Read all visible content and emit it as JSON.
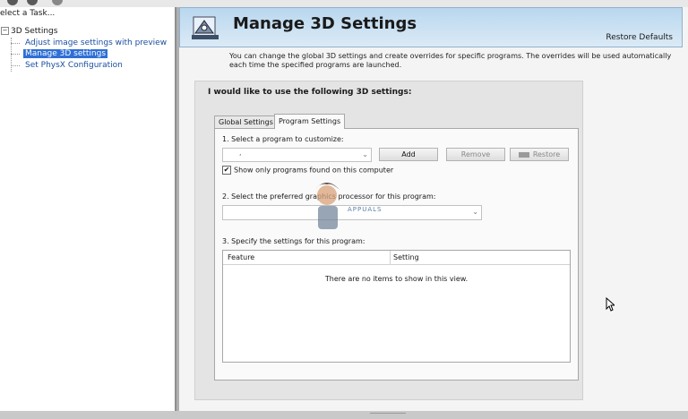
{
  "left_pane": {
    "header": "elect a Task...",
    "tree_root": "3D Settings",
    "tree_toggle": "−",
    "items": [
      {
        "label": "Adjust image settings with preview"
      },
      {
        "label": "Manage 3D settings",
        "selected": true
      },
      {
        "label": "Set PhysX Configuration"
      }
    ]
  },
  "banner": {
    "title": "Manage 3D Settings",
    "restore_defaults": "Restore Defaults",
    "icon": "3d-settings-icon"
  },
  "description": "You can change the global 3D settings and create overrides for specific programs. The overrides will be used automatically each time the specified programs are launched.",
  "settings": {
    "heading": "I would like to use the following 3D settings:",
    "tabs": [
      {
        "label": "Global Settings",
        "active": false
      },
      {
        "label": "Program Settings",
        "active": true
      }
    ],
    "step1": "1. Select a program to customize:",
    "program_value": ",",
    "add": "Add",
    "remove": "Remove",
    "restore": "Restore",
    "show_only": "Show only programs found on this computer",
    "show_only_checked": "✔",
    "step2": "2. Select the preferred graphics processor for this program:",
    "step3": "3. Specify the settings for this program:",
    "table": {
      "columns": [
        "Feature",
        "Setting"
      ],
      "empty_message": "There are no items to show in this view."
    }
  },
  "watermark": "APPUALS",
  "colors": {
    "selection": "#2f6fd6",
    "link": "#1a4fa0",
    "banner_top": "#b9d7ee"
  }
}
